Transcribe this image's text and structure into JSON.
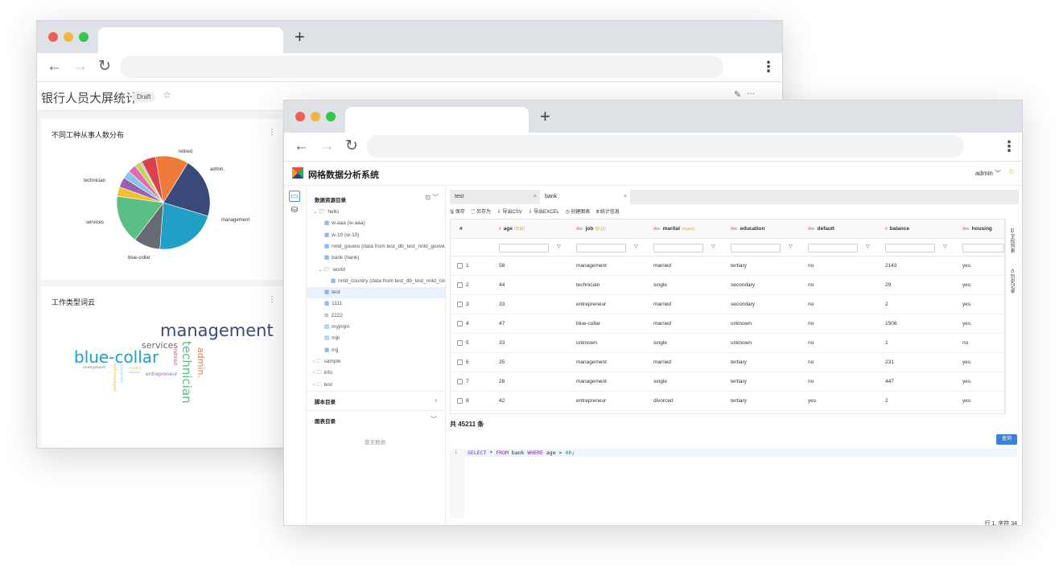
{
  "back_window": {
    "dashboard": {
      "title": "银行人员大屏统计",
      "badge": "Draft",
      "star_icon": "☆",
      "edit_icon": "✎",
      "more_icon": "···"
    },
    "pie_card": {
      "title": "不同工种从事人数分布",
      "more": "⋮",
      "chart_data": {
        "type": "pie",
        "title": "不同工种从事人数分布",
        "categories": [
          "management",
          "blue-collar",
          "technician",
          "services",
          "admin.",
          "retired",
          "entrepreneur",
          "self-employed",
          "unemployed",
          "housemaid",
          "student",
          "unknown"
        ],
        "values": [
          9458,
          9732,
          7597,
          4154,
          5171,
          2264,
          1487,
          1579,
          1303,
          1240,
          938,
          288
        ],
        "colors": [
          "#3a4a78",
          "#1fa0c4",
          "#5bbf85",
          "#666a72",
          "#ee7b3a",
          "#d9424c",
          "#f3c12f",
          "#9b5fb5",
          "#e56bb0",
          "#82c7e5",
          "#bfd45a",
          "#b9b9b9"
        ],
        "labels": {
          "retired": "retired",
          "admin": "admin.",
          "management": "management",
          "blue_collar": "blue-collar",
          "services": "services",
          "technician": "technician"
        }
      }
    },
    "cloud_card": {
      "title": "工作类型词云",
      "more": "⋮",
      "words": {
        "management": "management",
        "blue_collar": "blue-collar",
        "technician": "technician",
        "services": "services",
        "admin": "admin.",
        "retired": "retired",
        "entrepreneur": "entrepreneur",
        "self_employed": "self-employed",
        "unemployed": "unemployed",
        "housemaid": "housemaid",
        "student": "student",
        "unknown": "unknown"
      }
    }
  },
  "front_window": {
    "app_title": "网格数据分析系统",
    "user": "admin ﹀",
    "theme_icon": "☼",
    "rail": {
      "folder_icon": "▭",
      "db_icon": "⛁"
    },
    "tree": {
      "section_title": "数据资源目录",
      "section_icon": "⊡ ﹀",
      "items": [
        {
          "prefix": "⌄ 🗁",
          "label": "hello"
        },
        {
          "prefix": "▦",
          "label": "w-aaa (w-aaa)"
        },
        {
          "prefix": "▦",
          "label": "w-10 (w-10)"
        },
        {
          "prefix": "▦",
          "label": "nnld_gouwu (data from test_db_test_nnld_gouwu)"
        },
        {
          "prefix": "▦",
          "label": "bank (bank)"
        },
        {
          "prefix": "⌄ 🗁",
          "label": "world"
        },
        {
          "prefix": "▦",
          "label": "nnld_country (data from test_db_test_nnld_country)"
        },
        {
          "prefix": "▦",
          "label": "test"
        },
        {
          "prefix": "▦",
          "label": "1111"
        },
        {
          "prefix": "⊞",
          "label": "2222"
        },
        {
          "prefix": "▤",
          "label": "myjmjm"
        },
        {
          "prefix": "▤",
          "label": "mjk"
        },
        {
          "prefix": "▦",
          "label": "mjj"
        },
        {
          "prefix": "› 🗀",
          "label": "sample"
        },
        {
          "prefix": "› 🗀",
          "label": "info"
        },
        {
          "prefix": "› 🗀",
          "label": "test"
        }
      ],
      "script_section": "脚本目录",
      "script_arrow": "›",
      "chart_section": "图表目录",
      "chart_arrow": "﹀",
      "empty": "暂无数据"
    },
    "editor_tabs": [
      {
        "label": "test",
        "close": "×"
      },
      {
        "label": "bank",
        "close": "×"
      }
    ],
    "toolbar": {
      "save": "🖫 保存",
      "save_as": "🗋 另存为",
      "export_csv": "⇩ 导出CSV",
      "export_excel": "⇩ 导出EXCEL",
      "create_chart": "◷ 创建图表",
      "stats": "⩩ 统计信息"
    },
    "grid": {
      "columns": [
        {
          "type": "",
          "name": "#",
          "sub": ""
        },
        {
          "type": "#",
          "name": "age",
          "sub": "(年龄)"
        },
        {
          "type": "Abc",
          "name": "job",
          "sub": "(职业)"
        },
        {
          "type": "Abc",
          "name": "marital",
          "sub": "(wqww)"
        },
        {
          "type": "Abc",
          "name": "education",
          "sub": ""
        },
        {
          "type": "Abc",
          "name": "default",
          "sub": ""
        },
        {
          "type": "#",
          "name": "balance",
          "sub": ""
        },
        {
          "type": "Abc",
          "name": "housing",
          "sub": ""
        }
      ],
      "funnel": "▽",
      "rows": [
        [
          "1",
          "58",
          "management",
          "married",
          "tertiary",
          "no",
          "2143",
          "yes"
        ],
        [
          "2",
          "44",
          "technician",
          "single",
          "secondary",
          "no",
          "29",
          "yes"
        ],
        [
          "3",
          "33",
          "entrepreneur",
          "married",
          "secondary",
          "no",
          "2",
          "yes"
        ],
        [
          "4",
          "47",
          "blue-collar",
          "married",
          "unknown",
          "no",
          "1506",
          "yes"
        ],
        [
          "5",
          "33",
          "unknown",
          "single",
          "unknown",
          "no",
          "1",
          "no"
        ],
        [
          "6",
          "35",
          "management",
          "married",
          "tertiary",
          "no",
          "231",
          "yes"
        ],
        [
          "7",
          "28",
          "management",
          "single",
          "tertiary",
          "no",
          "447",
          "yes"
        ],
        [
          "8",
          "42",
          "entrepreneur",
          "divorced",
          "tertiary",
          "yes",
          "2",
          "yes"
        ]
      ]
    },
    "side_panel": {
      "field_list": "⊟ 字段列表",
      "history": "⟲ 历史记录"
    },
    "count": "共 45211 条",
    "run_button": "查询",
    "sql": {
      "line_no": "1",
      "select": "SELECT",
      "star": " * ",
      "from": "FROM",
      "table": " bank ",
      "where": "WHERE",
      "cond": " age > ",
      "value": "40",
      "end": ";"
    },
    "status": "行 1, 字符 34"
  }
}
